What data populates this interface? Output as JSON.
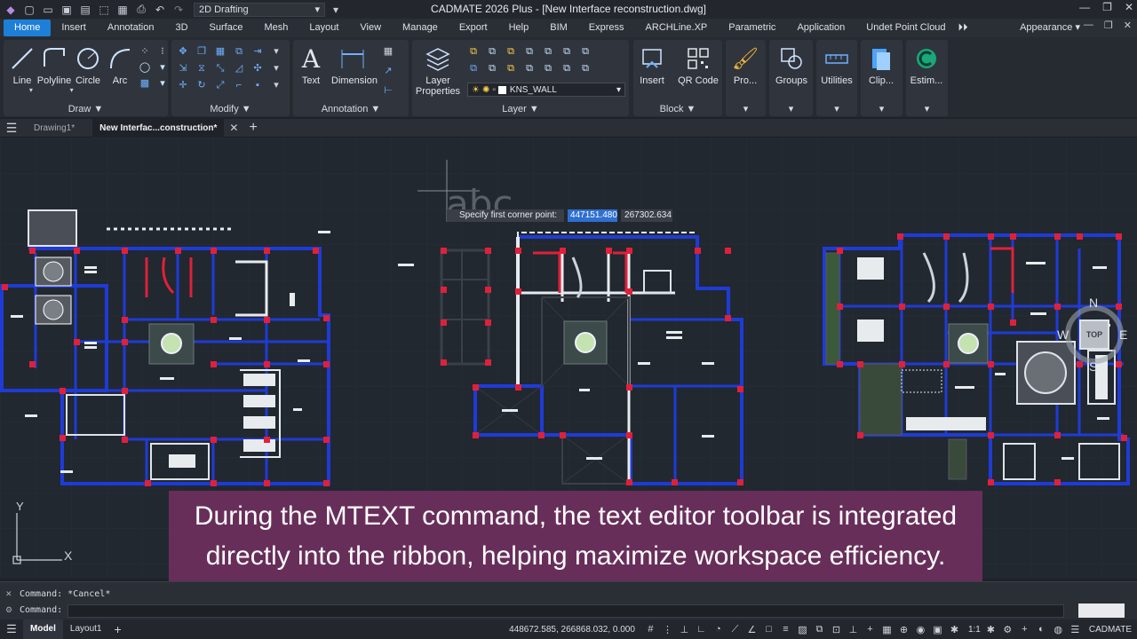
{
  "titlebar": {
    "app_title": "CADMATE 2026 Plus - [New Interface reconstruction.dwg]",
    "workspace": "2D Drafting",
    "quick_access": [
      "app-menu-icon",
      "new-file-icon",
      "open-file-icon",
      "save-icon",
      "save-as-icon",
      "export-icon",
      "plot-icon",
      "print-icon",
      "undo-icon",
      "redo-icon"
    ]
  },
  "menu": {
    "tabs": [
      "Home",
      "Insert",
      "Annotation",
      "3D",
      "Surface",
      "Mesh",
      "Layout",
      "View",
      "Manage",
      "Export",
      "Help",
      "BIM",
      "Express",
      "ARCHLine.XP",
      "Parametric",
      "Application",
      "Undet Point Cloud"
    ],
    "active_tab": "Home",
    "appearance": "Appearance ▾"
  },
  "ribbon": {
    "draw": {
      "label": "Draw ▼",
      "tools": [
        "Line",
        "Polyline",
        "Circle",
        "Arc"
      ]
    },
    "modify": {
      "label": "Modify ▼"
    },
    "annotation": {
      "label": "Annotation ▼",
      "tools": [
        "Text",
        "Dimension"
      ]
    },
    "layer": {
      "label": "Layer ▼",
      "properties": "Layer Properties",
      "current_layer": "KNS_WALL"
    },
    "block": {
      "label": "Block ▼",
      "tools": [
        "Insert",
        "QR Code"
      ]
    },
    "extra": [
      "Pro...",
      "Groups",
      "Utilities",
      "Clip...",
      "Estim..."
    ]
  },
  "doc_tabs": {
    "tabs": [
      "Drawing1*",
      "New Interfac...construction*"
    ],
    "active": 1
  },
  "canvas": {
    "prompt_label": "Specify first corner point:",
    "coord_x": "447151.480",
    "coord_y": "267302.634",
    "cursor_text": "abc",
    "ucs_y": "Y",
    "ucs_x": "X",
    "viewcube": {
      "top": "TOP",
      "n": "N",
      "s": "S",
      "e": "E",
      "w": "W"
    }
  },
  "caption": {
    "line1": "During the MTEXT command, the text editor toolbar is integrated",
    "line2": "directly into the ribbon, helping maximize workspace efficiency."
  },
  "command": {
    "history": "Command: *Cancel*",
    "prompt": "Command:"
  },
  "statusbar": {
    "tabs": [
      "Model",
      "Layout1"
    ],
    "coords": "448672.585, 266868.032, 0.000",
    "scale": "1:1",
    "brand": "CADMATE"
  },
  "colors": {
    "accent": "#1e7fd8",
    "caption_bg": "#783064",
    "wall_blue": "#1f3bd6",
    "column_red": "#e0203a"
  }
}
